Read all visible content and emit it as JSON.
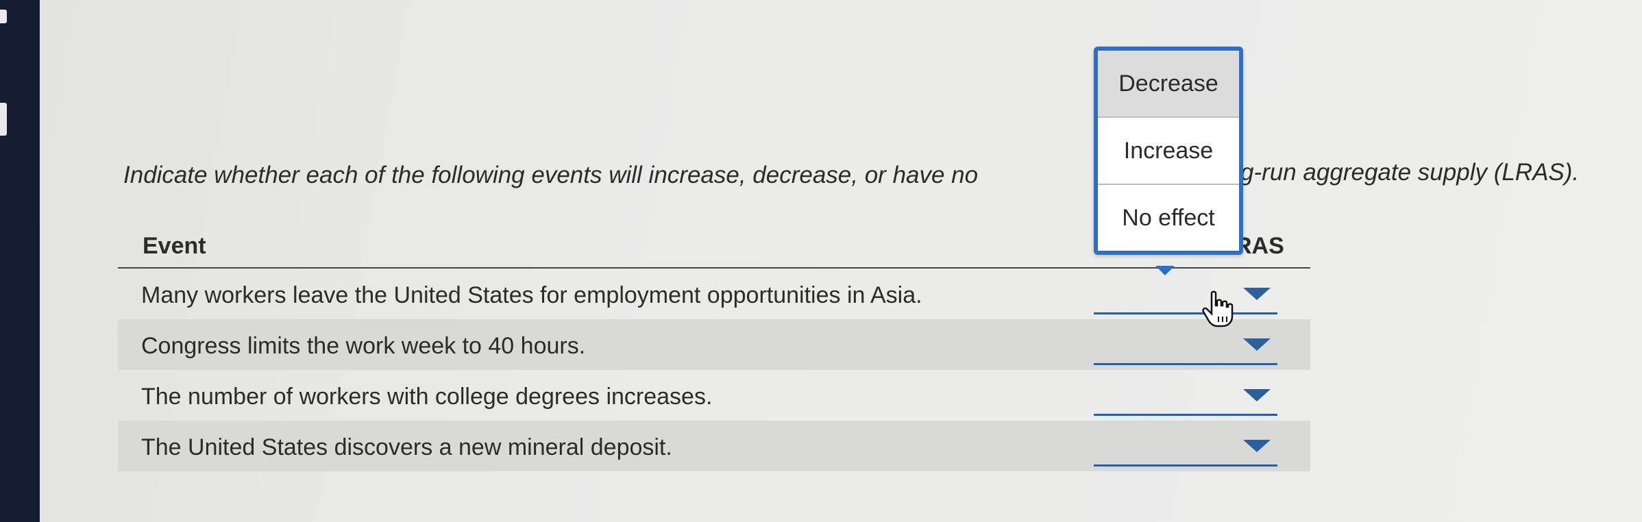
{
  "instruction": {
    "visible_left": "Indicate whether each of the following events will increase, decrease, or have no",
    "visible_right": "g-run aggregate supply (LRAS)."
  },
  "table": {
    "headers": {
      "event": "Event",
      "lras": "RAS"
    },
    "rows": [
      {
        "event": "Many workers leave the United States for employment opportunities in Asia.",
        "selected": ""
      },
      {
        "event": "Congress limits the work week to 40 hours.",
        "selected": ""
      },
      {
        "event": "The number of workers with college degrees increases.",
        "selected": ""
      },
      {
        "event": "The United States discovers a new mineral deposit.",
        "selected": ""
      }
    ]
  },
  "dropdown_menu": {
    "options": [
      "Decrease",
      "Increase",
      "No effect"
    ],
    "highlighted": "Decrease"
  },
  "colors": {
    "accent": "#2f6fc2",
    "dropdown_line": "#2d5f9a",
    "row_shade": "#d9d9d8",
    "bezel": "#151d33"
  },
  "icons": {
    "caret": "caret-down-icon",
    "cursor": "hand-pointer-icon"
  }
}
